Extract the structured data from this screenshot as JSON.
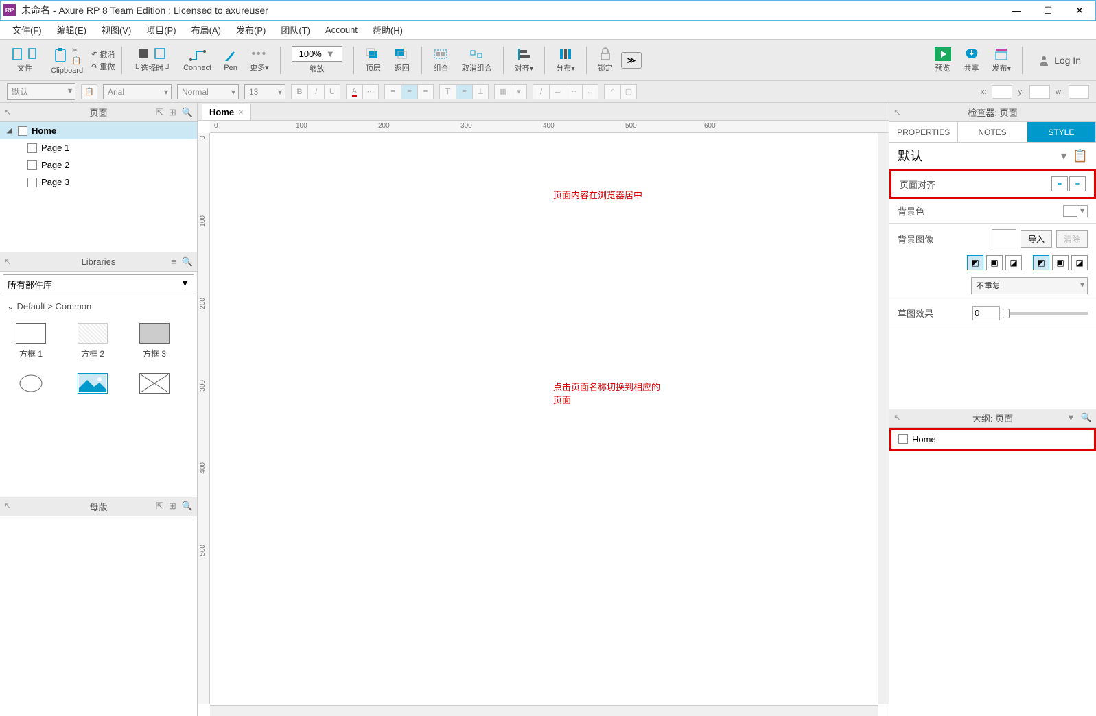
{
  "title": "未命名 - Axure RP 8 Team Edition : Licensed to axureuser",
  "menu": [
    "文件(F)",
    "编辑(E)",
    "视图(V)",
    "项目(P)",
    "布局(A)",
    "发布(P)",
    "团队(T)",
    "Account",
    "帮助(H)"
  ],
  "toolbar": {
    "file": "文件",
    "clipboard": "Clipboard",
    "undo": "撤消",
    "redo": "重做",
    "selectMode": "选择时",
    "connect": "Connect",
    "pen": "Pen",
    "more": "更多",
    "zoom": "缩放",
    "zoomValue": "100%",
    "front": "顶层",
    "back": "返回",
    "group": "组合",
    "ungroup": "取消组合",
    "align": "对齐",
    "distribute": "分布",
    "lock": "锁定",
    "preview": "预览",
    "share": "共享",
    "publish": "发布",
    "login": "Log In"
  },
  "format": {
    "style": "默认",
    "font": "Arial",
    "weight": "Normal",
    "size": "13",
    "x": "x:",
    "y": "y:",
    "w": "w:"
  },
  "panels": {
    "pages": "页面",
    "libraries": "Libraries",
    "masters": "母版",
    "inspector": "检查器: 页面",
    "outline": "大纲: 页面"
  },
  "pages": {
    "items": [
      {
        "name": "Home",
        "selected": true,
        "level": 0,
        "expanded": true
      },
      {
        "name": "Page 1",
        "selected": false,
        "level": 1
      },
      {
        "name": "Page 2",
        "selected": false,
        "level": 1
      },
      {
        "name": "Page 3",
        "selected": false,
        "level": 1
      }
    ]
  },
  "library": {
    "selector": "所有部件库",
    "path": "Default > Common",
    "widgets": [
      "方框 1",
      "方框 2",
      "方框 3"
    ]
  },
  "canvas": {
    "tab": "Home",
    "rulerH": [
      "0",
      "100",
      "200",
      "300",
      "400",
      "500",
      "600"
    ],
    "rulerV": [
      "0",
      "100",
      "200",
      "300",
      "400",
      "500"
    ],
    "annotation1": "页面内容在浏览器居中",
    "annotation2": "点击页面名称切换到相应的页面"
  },
  "inspector": {
    "tabs": [
      "PROPERTIES",
      "NOTES",
      "STYLE"
    ],
    "defaultLabel": "默认",
    "pageAlign": "页面对齐",
    "bgColor": "背景色",
    "bgImage": "背景图像",
    "import": "导入",
    "clear": "清除",
    "repeat": "不重复",
    "sketch": "草图效果",
    "sketchValue": "0"
  },
  "outline": {
    "item": "Home"
  }
}
